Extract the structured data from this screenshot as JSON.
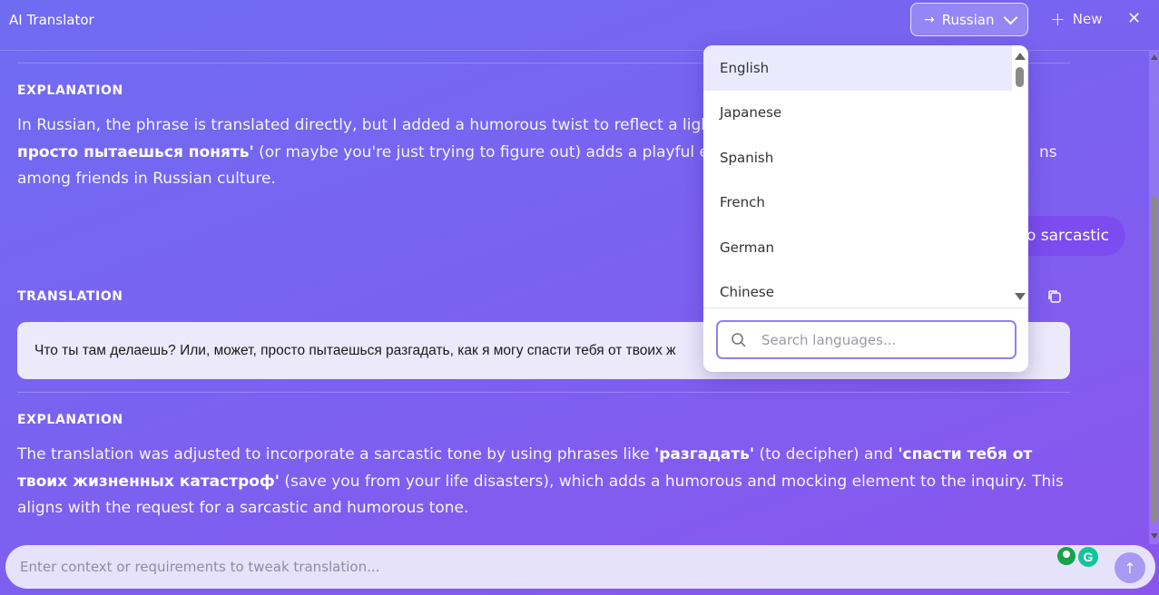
{
  "header": {
    "app_title": "AI Translator",
    "target_language": "Russian",
    "new_label": "New",
    "close_glyph": "✕",
    "arrow_glyph": "→"
  },
  "content": {
    "explanation_1": {
      "label": "EXPLANATION",
      "line1": "In Russian, the phrase is translated directly, but I added a humorous twist to reflect a light-h",
      "line2_bold": "просто пытаешься понять'",
      "line2_rest": " (or maybe you're just trying to figure out) adds a playful eleme",
      "line2_tail": "ns",
      "line3": "among friends in Russian culture."
    },
    "user_bubble_text": "o sarcastic",
    "translation": {
      "label": "TRANSLATION",
      "text": "Что ты там делаешь? Или, может, просто пытаешься разгадать, как я могу спасти тебя от твоих ж"
    },
    "explanation_2": {
      "label": "EXPLANATION",
      "t1": "The translation was adjusted to incorporate a sarcastic tone by using phrases like ",
      "b1": "'разгадать'",
      "t2": " (to decipher) and ",
      "b2": "'спасти тебя от твоих жизненных катастроф'",
      "t3": " (save you from your life disasters), which adds a humorous and mocking element to the inquiry. This aligns with the request for a sarcastic and humorous tone."
    }
  },
  "dropdown": {
    "options": [
      {
        "label": "English",
        "active": true
      },
      {
        "label": "Japanese"
      },
      {
        "label": "Spanish"
      },
      {
        "label": "French"
      },
      {
        "label": "German"
      },
      {
        "label": "Chinese"
      }
    ],
    "search_placeholder": "Search languages..."
  },
  "composer": {
    "placeholder": "Enter context or requirements to tweak translation...",
    "grammarly_letter": "G"
  },
  "colors": {
    "background": "#7a62f0",
    "accent": "#8d82ec",
    "bubble": "#7d4cf0"
  }
}
